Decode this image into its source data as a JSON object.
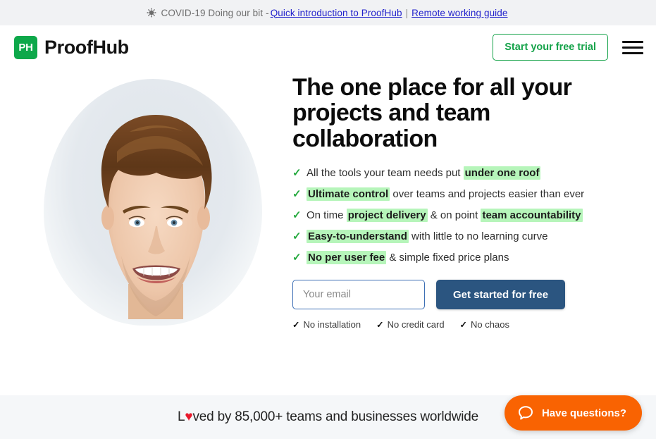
{
  "covid_banner": {
    "icon": "virus-icon",
    "text": "COVID-19 Doing our bit -",
    "link_primary": "Quick introduction to ProofHub",
    "separator": "|",
    "link_secondary": "Remote working guide",
    "link_color": "#2222cc",
    "background": "#f1f2f4"
  },
  "header": {
    "logo_mark": "PH",
    "logo_name": "ProofHub",
    "logo_color": "#0da84a",
    "trial_button": "Start your free trial",
    "trial_button_color": "#16a34a",
    "menu_icon": "hamburger-menu-icon"
  },
  "hero": {
    "headline": "The one place for all your projects and team collaboration",
    "image_alt": "smiling-man-portrait",
    "benefits": [
      {
        "parts": [
          {
            "text": "All the tools your team needs put ",
            "highlight": false
          },
          {
            "text": "under one roof",
            "highlight": true
          }
        ]
      },
      {
        "parts": [
          {
            "text": "Ultimate control",
            "highlight": true
          },
          {
            "text": " over teams and projects easier than ever",
            "highlight": false
          }
        ]
      },
      {
        "parts": [
          {
            "text": "On time ",
            "highlight": false
          },
          {
            "text": "project delivery",
            "highlight": true
          },
          {
            "text": " & on point ",
            "highlight": false
          },
          {
            "text": "team accountability",
            "highlight": true
          }
        ]
      },
      {
        "parts": [
          {
            "text": "Easy-to-understand",
            "highlight": true
          },
          {
            "text": " with little to no learning curve",
            "highlight": false
          }
        ]
      },
      {
        "parts": [
          {
            "text": "No per user fee",
            "highlight": true
          },
          {
            "text": " & simple fixed price plans",
            "highlight": false
          }
        ]
      }
    ],
    "check_color": "#22a83c",
    "highlight_color": "#b6f5ba",
    "form": {
      "email_value": "",
      "email_placeholder": "Your email",
      "submit_label": "Get started for free",
      "submit_color": "#2b5580",
      "input_border_color": "#3d6fb5"
    },
    "assurances": [
      "No installation",
      "No credit card",
      "No chaos"
    ]
  },
  "bottom": {
    "loved_prefix": "L",
    "loved_heart": "♥",
    "loved_suffix": "ved by 85,000+ teams and businesses worldwide",
    "heart_color": "#e8192c",
    "background": "#f5f7f9"
  },
  "chat_widget": {
    "icon": "chat-bubble-icon",
    "label": "Have questions?",
    "color": "#f96302"
  }
}
